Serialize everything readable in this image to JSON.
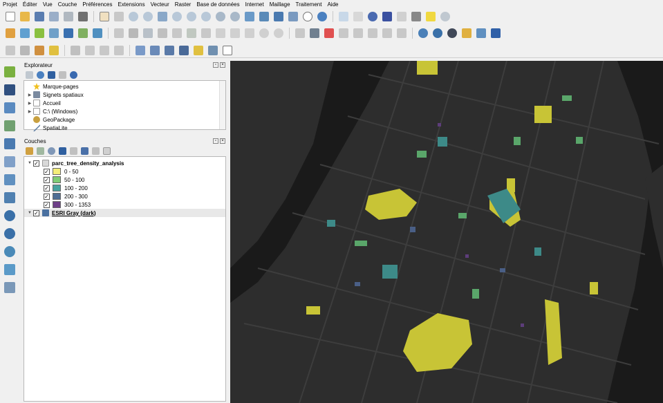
{
  "menu": [
    "Projet",
    "Éditer",
    "Vue",
    "Couche",
    "Préférences",
    "Extensions",
    "Vecteur",
    "Raster",
    "Base de données",
    "Internet",
    "Maillage",
    "Traitement",
    "Aide"
  ],
  "explorer": {
    "title": "Explorateur",
    "items": [
      {
        "label": "Marque-pages",
        "icon": "star-icon",
        "color": "#f0c020"
      },
      {
        "label": "Signets spatiaux",
        "icon": "bookmark-icon",
        "color": "#7a8aa0"
      },
      {
        "label": "Accueil",
        "icon": "folder-home-icon",
        "color": "#a0a0a0"
      },
      {
        "label": "C:\\ (Windows)",
        "icon": "drive-icon",
        "color": "#a0a0a0"
      },
      {
        "label": "GeoPackage",
        "icon": "geopackage-icon",
        "color": "#c8a040"
      },
      {
        "label": "SpatiaLite",
        "icon": "spatialite-icon",
        "color": "#5a7aa0"
      }
    ]
  },
  "layers": {
    "title": "Couches",
    "group_layer": "parc_tree_density_analysis",
    "classes": [
      {
        "label": "0 - 50",
        "color": "#f4ee7a"
      },
      {
        "label": "50 - 100",
        "color": "#7fcd76"
      },
      {
        "label": "100 - 200",
        "color": "#48a3a0"
      },
      {
        "label": "200 - 300",
        "color": "#4e6d94"
      },
      {
        "label": "300 - 1353",
        "color": "#6e3f88"
      }
    ],
    "basemap": "ESRI Gray (dark)"
  },
  "map_colors": {
    "background": "#2d2d2d",
    "water": "#1a1a1a",
    "roads": "#3d3d3d",
    "parks": [
      "#c8c436",
      "#5aa66a",
      "#3d8a88",
      "#4a5f86",
      "#5d3d7a"
    ]
  }
}
